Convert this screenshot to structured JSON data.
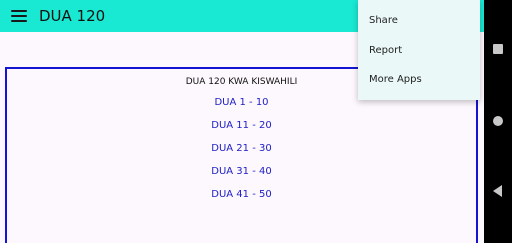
{
  "appbar": {
    "title": "DUA 120",
    "menu_icon": "hamburger-menu-icon"
  },
  "card": {
    "title": "DUA 120 KWA KISWAHILI",
    "items": [
      "DUA 1 - 10",
      "DUA 11 - 20",
      "DUA 21 - 30",
      "DUA 31 - 40",
      "DUA 41 - 50"
    ]
  },
  "overflow_menu": {
    "items": [
      "Share",
      "Report",
      "More Apps"
    ]
  },
  "system_nav": {
    "icons": [
      "recents-square-icon",
      "home-circle-icon",
      "back-triangle-icon"
    ]
  },
  "colors": {
    "appbar": "#19e8d2",
    "card_border": "#1414d2",
    "link": "#2020c8",
    "menu_bg": "#ebf8f8"
  }
}
